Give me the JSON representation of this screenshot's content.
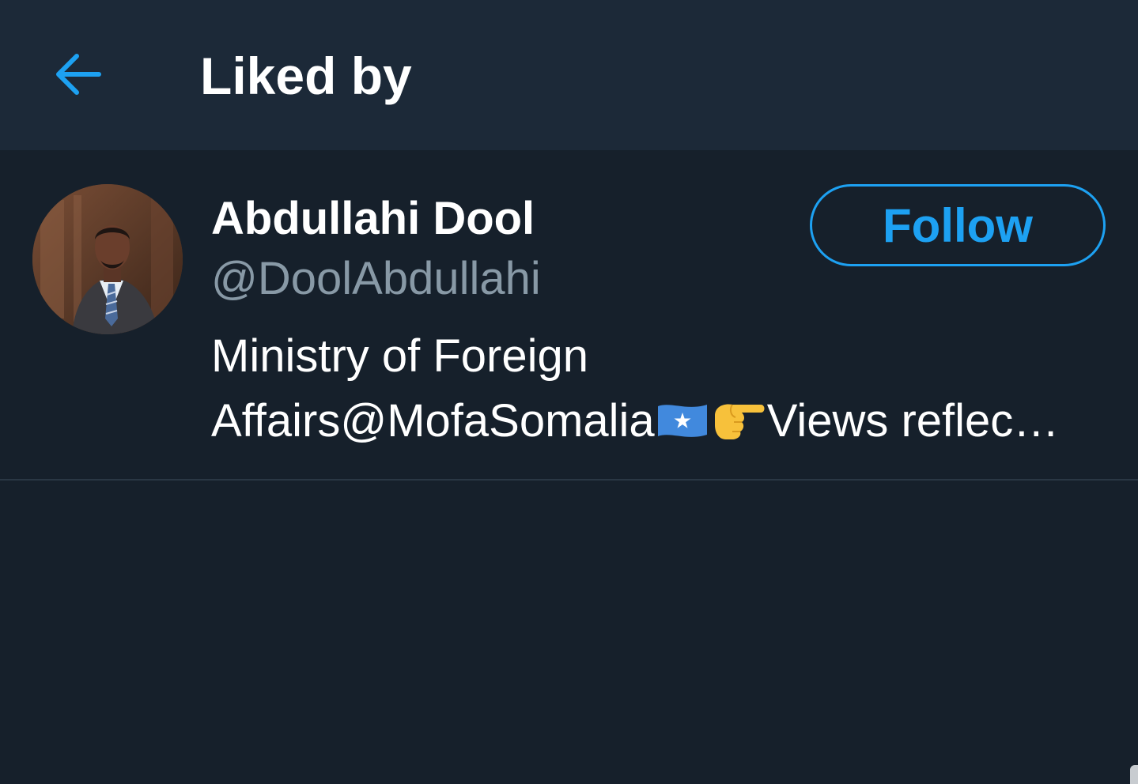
{
  "header": {
    "title": "Liked by",
    "back_icon": "arrow-left-icon",
    "accent_color": "#1da1f2"
  },
  "users": [
    {
      "display_name": "Abdullahi Dool",
      "handle": "@DoolAbdullahi",
      "bio_line1": "Ministry of Foreign",
      "bio_line2_start": "Affairs@MofaSomalia",
      "bio_line2_end": "Views reflec…",
      "bio_emojis": [
        "somalia-flag-emoji",
        "pointing-right-emoji"
      ],
      "follow_label": "Follow",
      "avatar": "profile-photo"
    }
  ],
  "colors": {
    "background": "#16202b",
    "header_background": "#1c2938",
    "primary_text": "#ffffff",
    "secondary_text": "#8899a6",
    "accent": "#1da1f2",
    "divider": "#2a3744"
  }
}
